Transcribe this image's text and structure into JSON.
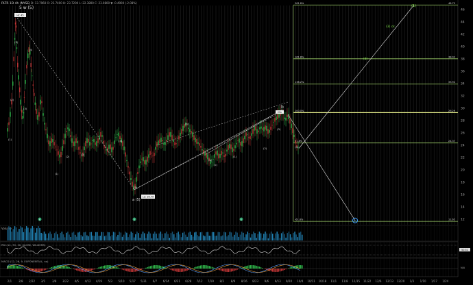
{
  "header": {
    "title": "PLTR 1D 4h (NYSE)",
    "quote": "D: 13.7960 O: 22.7400 H: 23.7200 L: 22.3800 C: 23.0800 ▼ -0.4900 (-2.08%)"
  },
  "colors": {
    "background": "#000000",
    "up_candle": "#2fb84a",
    "down_candle": "#c23535",
    "fib_line": "#9fd16a",
    "fib_line_highlight": "#e8f28c",
    "wave_green": "#7fe04a",
    "trendline": "#cfcfcf",
    "vline": "#2a2a2a"
  },
  "wave_labels": {
    "top": "5 w (5)",
    "major_low": "a (5)",
    "b_top": "b",
    "c_target": "c",
    "small": [
      "(1)",
      "(2)",
      "(3)",
      "(4)",
      "(5)",
      "(1)",
      "(2)",
      "(3)",
      "(4)",
      "(5)",
      "(a)",
      "(b)",
      "(c)",
      "(1)",
      "(2)",
      "(3)",
      "(4)"
    ],
    "green_1": "(1)",
    "green_2": "(3) ck",
    "green_3": "(3)"
  },
  "price_callouts": {
    "high": "Hi: 45",
    "low": "Lo: 16.79",
    "b_high": "29c"
  },
  "fib_levels": [
    {
      "pct": "261.8%",
      "value": "46.75"
    },
    {
      "pct": "161.8%",
      "value": "38.02"
    },
    {
      "pct": "138.2%",
      "value": "33.92"
    },
    {
      "pct": "100.0%",
      "value": "29.29"
    },
    {
      "pct": "61.8%",
      "value": "24.37"
    },
    {
      "pct": "-61.8%",
      "value": "11.65"
    }
  ],
  "price_axis": [
    "46",
    "44",
    "42",
    "40",
    "38",
    "36",
    "34",
    "32",
    "30",
    "28",
    "26",
    "24",
    "22",
    "20",
    "18",
    "16",
    "14",
    "12"
  ],
  "date_axis": [
    "2/1",
    "2/8",
    "2/22",
    "3/1",
    "3/8",
    "3/22",
    "4/5",
    "4/12",
    "4/19",
    "5/3",
    "5/10",
    "5/17",
    "5/31",
    "6/7",
    "6/14",
    "6/21",
    "6/28",
    "7/12",
    "7/19",
    "8/2",
    "8/9",
    "8/16",
    "8/23",
    "9/6",
    "9/13",
    "9/20",
    "10/4",
    "10/11",
    "10/18",
    "11/1",
    "11/8",
    "11/15",
    "11/22",
    "12/6",
    "12/13",
    "12/20",
    "1/3",
    "1/10",
    "1/17",
    "1/24"
  ],
  "subpanels": {
    "volume_label": "Volume",
    "rsi_label": "RSI (14, 70, 30, CLOSE, WILDERS)",
    "rsi_value": "50.51",
    "macd_label": "MACD (12, 26, 9, EXPONENTIAL, no)",
    "macd_value": "N/A"
  },
  "earnings_markers": [
    "E",
    "E",
    "E"
  ]
}
